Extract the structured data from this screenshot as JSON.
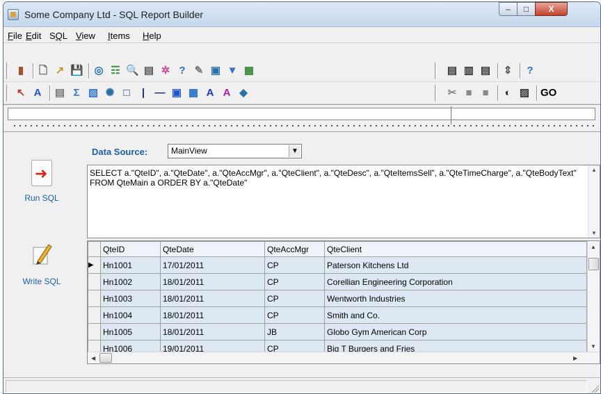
{
  "window": {
    "title": "Some Company Ltd - SQL Report Builder"
  },
  "caption_buttons": {
    "minimize": "–",
    "maximize": "□",
    "close": "X"
  },
  "menu": [
    {
      "pre": "",
      "key": "F",
      "post": "ile"
    },
    {
      "pre": "",
      "key": "E",
      "post": "dit"
    },
    {
      "pre": "S",
      "key": "Q",
      "post": "L"
    },
    {
      "pre": "",
      "key": "V",
      "post": "iew"
    },
    {
      "pre": "",
      "key": "I",
      "post": "tems"
    },
    {
      "pre": "",
      "key": "H",
      "post": "elp"
    }
  ],
  "sidebar": {
    "run_sql": "Run SQL",
    "write_sql": "Write SQL"
  },
  "data_source": {
    "label": "Data Source:",
    "value": "MainView"
  },
  "sql": {
    "text": "SELECT a.\"QteID\", a.\"QteDate\", a.\"QteAccMgr\", a.\"QteClient\", a.\"QteDesc\", a.\"QteItemsSell\", a.\"QteTimeCharge\", a.\"QteBodyText\" FROM QteMain a   ORDER BY a.\"QteDate\""
  },
  "grid": {
    "columns": [
      "QteID",
      "QteDate",
      "QteAccMgr",
      "QteClient"
    ],
    "rows": [
      [
        "Hn1001",
        "17/01/2011",
        "CP",
        "Paterson Kitchens Ltd"
      ],
      [
        "Hn1002",
        "18/01/2011",
        "CP",
        "Corellian Engineering Corporation"
      ],
      [
        "Hn1003",
        "18/01/2011",
        "CP",
        "Wentworth Industries"
      ],
      [
        "Hn1004",
        "18/01/2011",
        "CP",
        "Smith and Co."
      ],
      [
        "Hn1005",
        "18/01/2011",
        "JB",
        "Globo Gym American Corp"
      ],
      [
        "Hn1006",
        "19/01/2011",
        "CP",
        "Big T Burgers and Fries"
      ]
    ],
    "current_row": 0
  },
  "toolbar_icons": {
    "row1_left": [
      "exit-icon",
      "new-icon",
      "open-icon",
      "save-icon",
      "web-icon",
      "database-icon",
      "search-icon",
      "table-icon",
      "puzzle-icon",
      "query-icon",
      "wizard-icon",
      "preview-icon",
      "filter-icon",
      "export-icon"
    ],
    "row1_right": [
      "page-icon",
      "calendar-icon",
      "list-icon",
      "spin-icon",
      "help-icon"
    ],
    "row2_left": [
      "pointer-icon",
      "text-icon",
      "memo-icon",
      "sum-icon",
      "image-icon",
      "gear-icon",
      "rectangle-icon",
      "vline-icon",
      "hline-icon",
      "label-icon",
      "chart-icon",
      "richtext-icon",
      "richtext2-icon",
      "dbimage-icon"
    ],
    "row2_right": [
      "cut-icon",
      "copy-icon",
      "paste-icon",
      "align-icon",
      "hatch-icon",
      "go-icon"
    ]
  },
  "toolbar_glyphs": {
    "row1_left": [
      "▮",
      "🗋",
      "↗",
      "💾",
      "◎",
      "☶",
      "🔍",
      "▤",
      "✲",
      "?",
      "✎",
      "▣",
      "▼",
      "▦"
    ],
    "row1_right": [
      "▤",
      "▥",
      "▤",
      "⇕",
      "?"
    ],
    "row2_left": [
      "↖",
      "A",
      "▤",
      "Σ",
      "▧",
      "✺",
      "□",
      "|",
      "—",
      "▣",
      "▦",
      "A",
      "A",
      "◆"
    ],
    "row2_right": [
      "✂",
      "■",
      "■",
      "◐",
      "▨",
      "GO"
    ]
  },
  "colors": {
    "accent_blue": "#1f5fa8",
    "grid_cell": "#dde8f3",
    "close_red": "#c4412c"
  }
}
